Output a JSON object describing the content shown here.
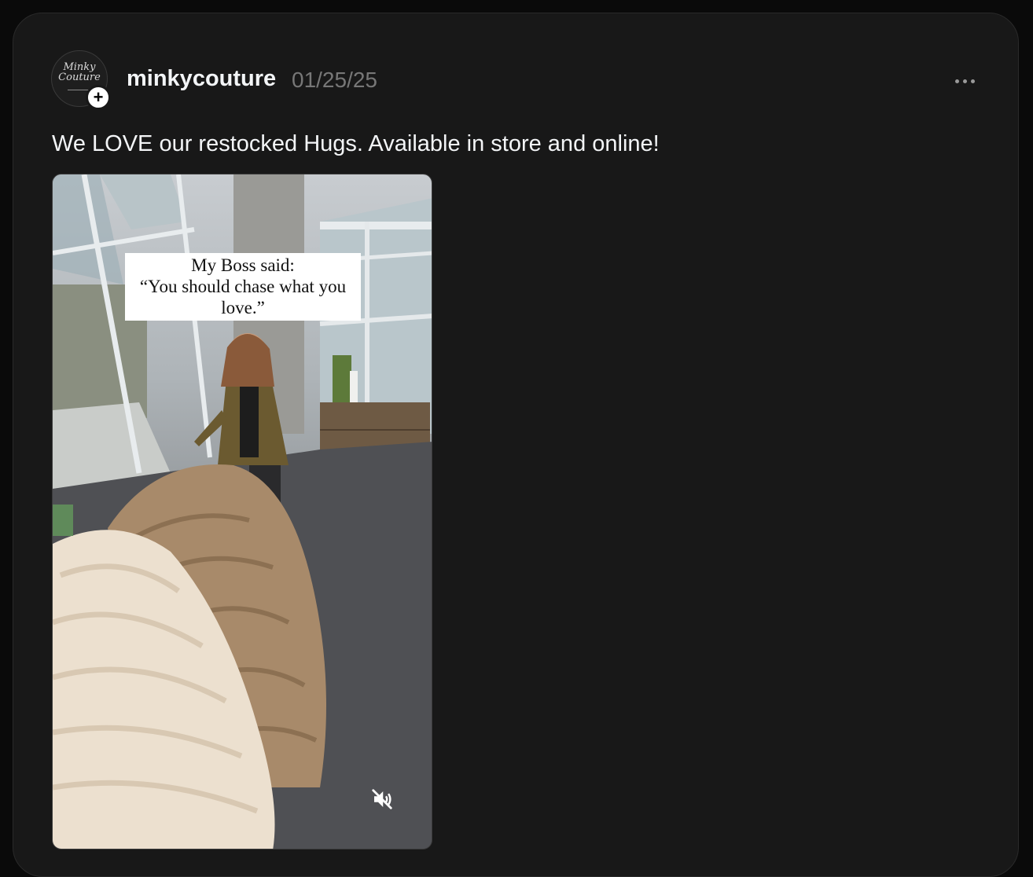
{
  "post": {
    "username": "minkycouture",
    "date": "01/25/25",
    "avatar_text": "Minky Couture",
    "caption": "We LOVE our restocked Hugs. Available in store and online!",
    "video_overlay": {
      "line1": "My Boss said:",
      "line2": "“You should chase what you",
      "line3": "love.”"
    },
    "follow_symbol": "+"
  },
  "icons": {
    "more": "more-horizontal-icon",
    "mute": "speaker-muted-icon",
    "follow": "plus-icon"
  },
  "colors": {
    "background": "#0a0a0a",
    "card": "#181818",
    "text_primary": "#f3f5f7",
    "text_secondary": "#777777"
  }
}
